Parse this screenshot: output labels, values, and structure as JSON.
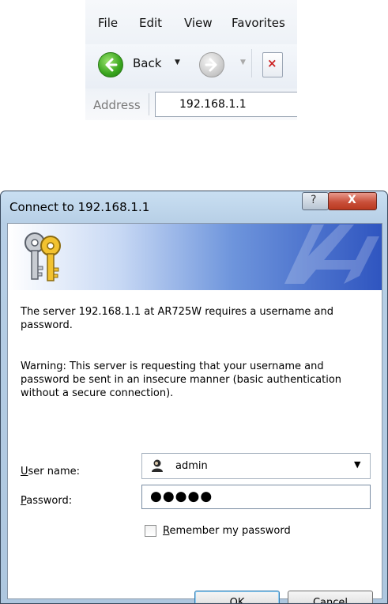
{
  "browser": {
    "menu": [
      "File",
      "Edit",
      "View",
      "Favorites"
    ],
    "toolbar": {
      "back_label": "Back"
    },
    "address": {
      "label": "Address",
      "value": "192.168.1.1"
    }
  },
  "dialog": {
    "title": "Connect to 192.168.1.1",
    "help_glyph": "?",
    "close_glyph": "X",
    "message": "The server 192.168.1.1 at AR725W requires a username and password.",
    "warning": "Warning: This server is requesting that your username and password be sent in an insecure manner (basic authentication without a secure connection).",
    "username": {
      "label_underlined": "U",
      "label_rest": "ser name:",
      "value": "admin"
    },
    "password": {
      "label_underlined": "P",
      "label_rest": "assword:",
      "mask": "●●●●●"
    },
    "remember": {
      "label_underlined": "R",
      "label_rest": "emember my password",
      "checked": false
    },
    "buttons": {
      "ok": "OK",
      "cancel": "Cancel"
    }
  },
  "colors": {
    "accent_blue": "#2f55c0",
    "close_red": "#c9503b",
    "back_green": "#39a51e"
  }
}
